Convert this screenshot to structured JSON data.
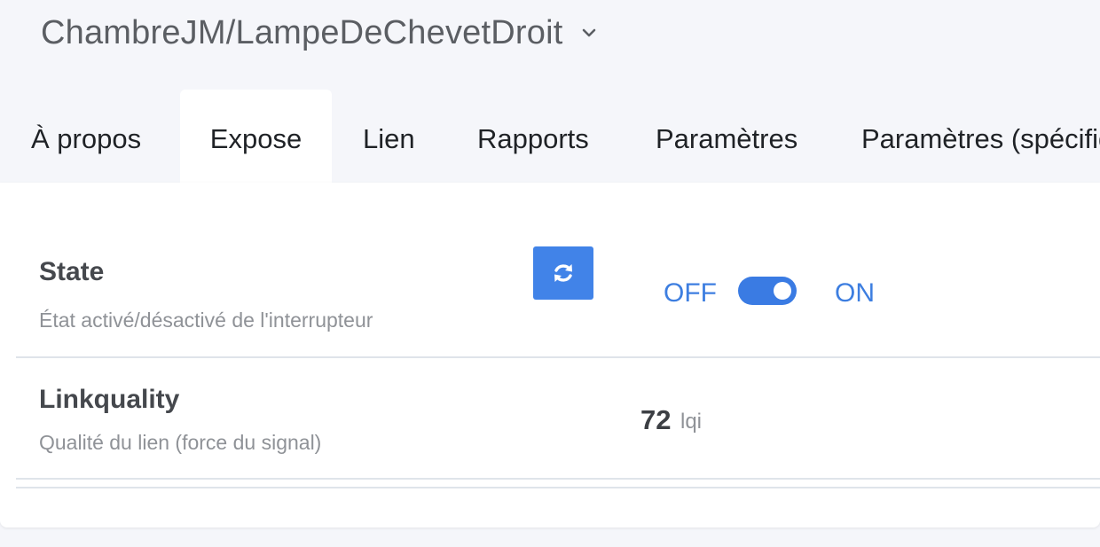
{
  "device": {
    "title": "ChambreJM/LampeDeChevetDroit"
  },
  "tabs": [
    {
      "label": "À propos",
      "active": false
    },
    {
      "label": "Expose",
      "active": true
    },
    {
      "label": "Lien",
      "active": false
    },
    {
      "label": "Rapports",
      "active": false
    },
    {
      "label": "Paramètres",
      "active": false
    },
    {
      "label": "Paramètres (spécifiques)",
      "active": false
    }
  ],
  "exposes": {
    "state": {
      "title": "State",
      "description": "État activé/désactivé de l'interrupteur",
      "off_label": "OFF",
      "on_label": "ON",
      "value": "ON",
      "refresh_icon": "refresh-icon"
    },
    "linkquality": {
      "title": "Linkquality",
      "description": "Qualité du lien (force du signal)",
      "value": "72",
      "unit": "lqi"
    }
  },
  "colors": {
    "accent": "#4183e8",
    "toggle_on": "#3a7be3",
    "label_blue": "#3d7ee0",
    "page_bg": "#f5f6fa"
  }
}
